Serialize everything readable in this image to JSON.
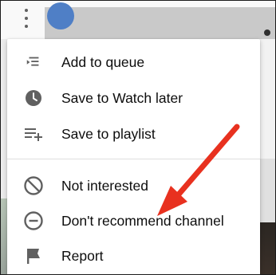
{
  "menu": {
    "items": [
      {
        "label": "Add to queue",
        "icon": "add-to-queue-icon"
      },
      {
        "label": "Save to Watch later",
        "icon": "clock-icon"
      },
      {
        "label": "Save to playlist",
        "icon": "playlist-add-icon"
      },
      {
        "label": "Not interested",
        "icon": "block-icon"
      },
      {
        "label": "Don't recommend channel",
        "icon": "remove-circle-icon"
      },
      {
        "label": "Report",
        "icon": "flag-icon"
      }
    ]
  },
  "annotation": {
    "arrow_color": "#e8311f",
    "icon": "red-arrow-icon"
  },
  "colors": {
    "icon_gray": "#606060",
    "text": "#0d0d0d"
  }
}
